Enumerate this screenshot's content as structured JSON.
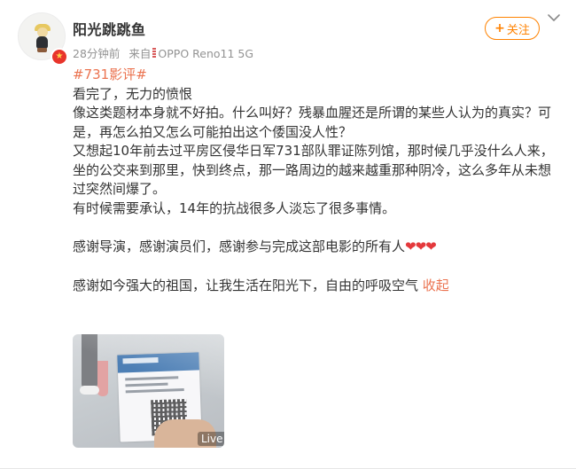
{
  "post": {
    "username": "阳光跳跳鱼",
    "time": "28分钟前",
    "source_prefix": "来自",
    "source_device": "OPPO Reno11 5G",
    "follow_label": "关注",
    "topic": "#731影评#",
    "lines": [
      "看完了，无力的愤恨",
      "像这类题材本身就不好拍。什么叫好？残暴血腥还是所谓的某些人认为的真实？可是，再怎么拍又怎么可能拍出这个倭国没人性？",
      "又想起10年前去过平房区侵华日军731部队罪证陈列馆，那时候几乎没什么人来，坐的公交来到那里，快到终点，那一路周边的越来越重那种阴冷，这么多年从未想过突然间爆了。",
      "有时候需要承认，14年的抗战很多人淡忘了很多事情。"
    ],
    "thanks_line": "感谢导演，感谢演员们，感谢参与完成这部电影的所有人",
    "thanks_hearts": "❤❤❤",
    "last_line": "感谢如今强大的祖国，让我生活在阳光下，自由的呼吸空气",
    "collapse_label": "收起",
    "photo_badge": "Live",
    "icons": {
      "more": "chevron-down-icon",
      "verified": "verified-badge-icon",
      "source": "device-icon"
    },
    "colors": {
      "accent": "#ff8200",
      "link": "#eb7350",
      "heart": "#e4393c"
    }
  }
}
